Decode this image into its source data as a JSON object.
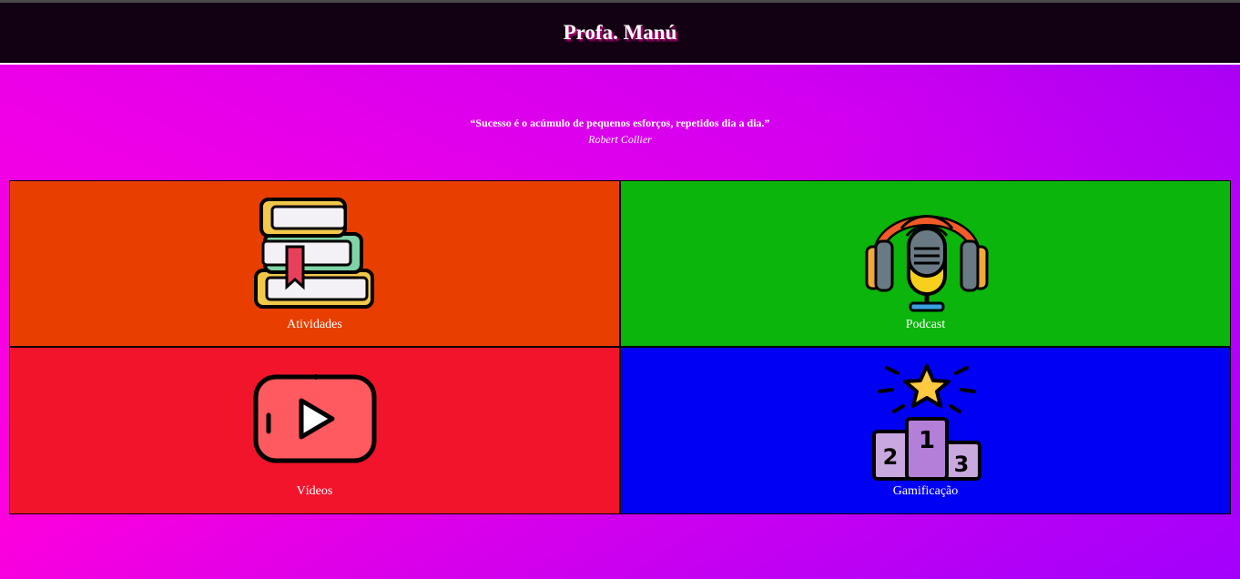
{
  "header": {
    "title": "Profa. Manú"
  },
  "quote": {
    "text": "“Sucesso é o acúmulo de pequenos esforços, repetidos dia a dia.”",
    "author": "Robert Collier"
  },
  "cards": [
    {
      "label": "Atividades",
      "color": "#e83e00",
      "icon": "books-icon"
    },
    {
      "label": "Podcast",
      "color": "#0bb50b",
      "icon": "podcast-microphone-icon"
    },
    {
      "label": "Vídeos",
      "color": "#f2142b",
      "icon": "video-play-icon"
    },
    {
      "label": "Gamificação",
      "color": "#0000f3",
      "icon": "podium-star-icon"
    }
  ]
}
